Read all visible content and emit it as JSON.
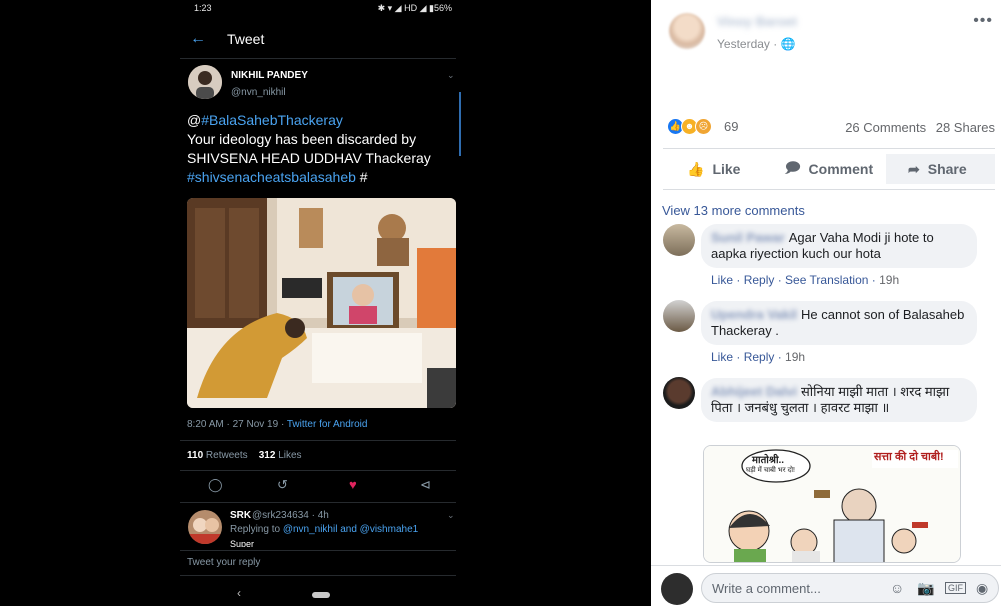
{
  "twitter": {
    "status_time": "1:23",
    "status_right": "✱ ▾ ◢ HD ◢ ▮56%",
    "header_title": "Tweet",
    "tweet": {
      "name": "NIKHIL PANDEY",
      "handle": "@nvn_nikhil",
      "text_at": "@",
      "text_tag1": "#BalaSahebThackeray",
      "text_body": "Your ideology has been discarded by SHIVSENA HEAD UDDHAV Thackeray",
      "text_tag2": "#shivsenacheatsbalasaheb",
      "text_tail": " #",
      "time": "8:20 AM · 27 Nov 19 · ",
      "client": "Twitter for Android",
      "retweets": "110",
      "retweets_label": "Retweets",
      "likes": "312",
      "likes_label": "Likes"
    },
    "reply": {
      "name": "SRK",
      "handle": "@srk234634 · 4h",
      "replying_to": "Replying to ",
      "replying_users": "@nvn_nikhil and @vishmahe1",
      "text": "Super"
    },
    "compose_placeholder": "Tweet your reply"
  },
  "facebook": {
    "poster_name": "Vinoy Baroet",
    "post_time": "Yesterday · ",
    "reaction_count": "69",
    "comments_count": "26 Comments",
    "shares_count": "28 Shares",
    "like_label": "Like",
    "comment_label": "Comment",
    "share_label": "Share",
    "view_more": "View 13 more comments",
    "comments": [
      {
        "author": "Sunil Pawar",
        "text": "Agar Vaha Modi ji hote to aapka riyection kuch our hota",
        "like": "Like",
        "reply": "Reply",
        "translate": "See Translation",
        "time": "19h"
      },
      {
        "author": "Upendra Vakil",
        "text": "He cannot son of Balasaheb Thackeray .",
        "like": "Like",
        "reply": "Reply",
        "time": "19h"
      },
      {
        "author": "Abhijeet Dalvi",
        "text": "सोनिया माझी माता । शरद माझा पिता । जनबंधु चुलता । हावरट माझा ॥"
      }
    ],
    "cartoon": {
      "bubble_left": "मातोश्री..",
      "bubble_left_small": "घड़ी में चाबी भर दो!",
      "bubble_right": "सत्ता की दो चाबी!"
    },
    "write_placeholder": "Write a comment...",
    "colors": {
      "link": "#385898",
      "like_blue": "#1877f2",
      "angry": "#f0a533"
    }
  }
}
